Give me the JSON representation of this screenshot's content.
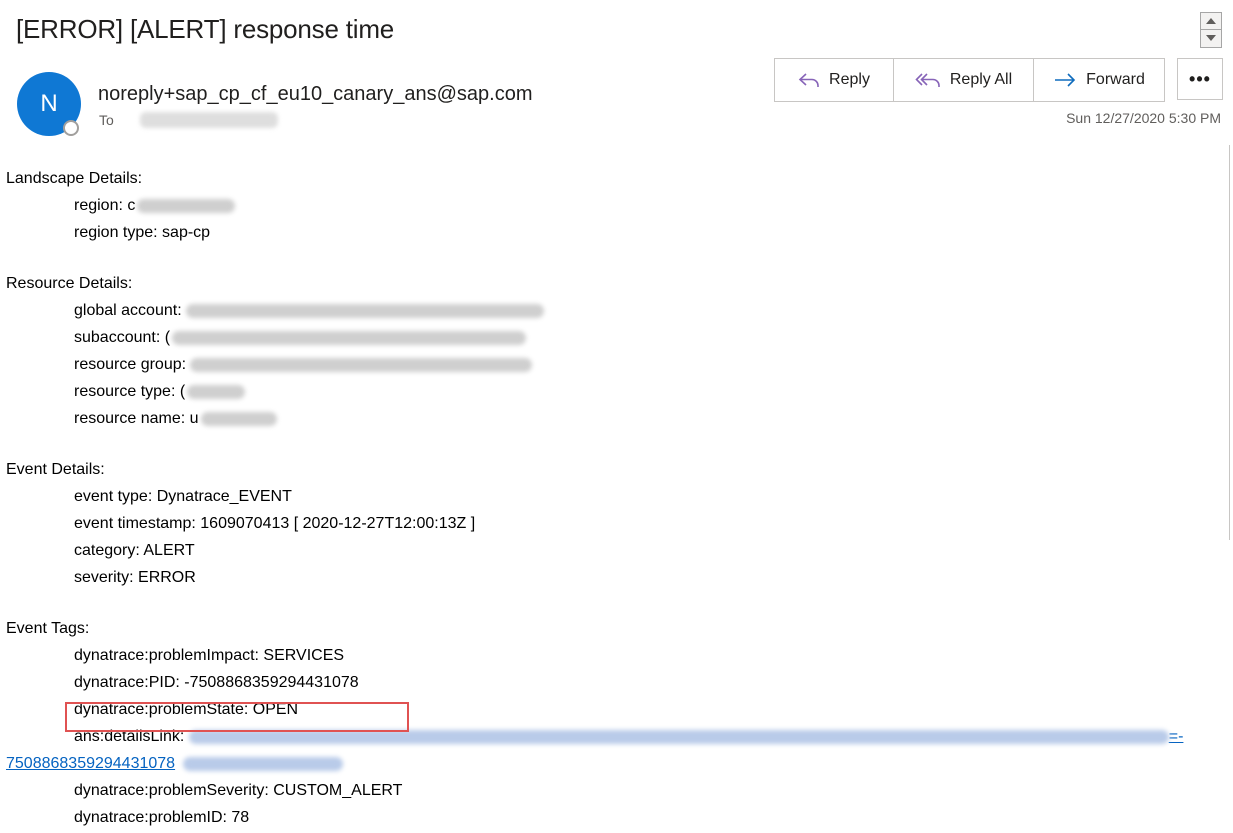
{
  "message": {
    "subject": "[ERROR] [ALERT] response time",
    "avatar_initial": "N",
    "sender": "noreply+sap_cp_cf_eu10_canary_ans@sap.com",
    "to_label": "To",
    "datetime": "Sun 12/27/2020 5:30 PM"
  },
  "toolbar": {
    "reply_label": "Reply",
    "reply_all_label": "Reply All",
    "forward_label": "Forward",
    "more_label": "•••"
  },
  "body": {
    "landscape": {
      "title": "Landscape Details:",
      "region_label": "region: c",
      "region_type": "region type: sap-cp"
    },
    "resource": {
      "title": "Resource Details:",
      "global_account_label": "global account:",
      "subaccount_label": "subaccount: (",
      "resource_group_label": "resource group:",
      "resource_type_label": "resource type: (",
      "resource_name_label": "resource name: u"
    },
    "event": {
      "title": "Event Details:",
      "event_type": "event type: Dynatrace_EVENT",
      "event_timestamp": "event timestamp: 1609070413 [ 2020-12-27T12:00:13Z ]",
      "category": "category: ALERT",
      "severity": "severity: ERROR"
    },
    "tags": {
      "title": "Event Tags:",
      "problem_impact": "dynatrace:problemImpact: SERVICES",
      "pid": "dynatrace:PID: -7508868359294431078",
      "problem_state": "dynatrace:problemState: OPEN",
      "details_link_label": "ans:detailsLink:",
      "details_link_tail": "=-",
      "details_link_cont": "7508868359294431078",
      "problem_severity": "dynatrace:problemSeverity: CUSTOM_ALERT",
      "problem_id": "dynatrace:problemID: 78"
    }
  },
  "colors": {
    "avatar": "#0f78d4",
    "link": "#0563c1",
    "highlight_box": "#e05252",
    "icon_purple": "#8764b8",
    "icon_blue": "#0f6cbd"
  }
}
